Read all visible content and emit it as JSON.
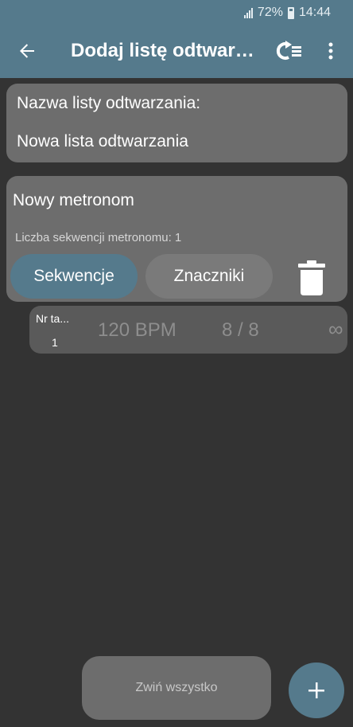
{
  "status_bar": {
    "battery": "72%",
    "time": "14:44"
  },
  "app_bar": {
    "title": "Dodaj listę odtwarzania",
    "back_icon": "arrow-left-icon",
    "sync_icon": "sync-list-icon",
    "menu_icon": "more-vert-icon"
  },
  "playlist": {
    "label": "Nazwa listy odtwarzania:",
    "name_value": "Nowa lista odtwarzania"
  },
  "metronome": {
    "name": "Nowy metronom",
    "sequence_count_text": "Liczba sekwencji metronomu: 1",
    "sequences_button": "Sekwencje",
    "markers_button": "Znaczniki",
    "delete_icon": "trash-icon"
  },
  "sequence": {
    "nr_label": "Nr ta...",
    "nr_value": "1",
    "bpm": "120 BPM",
    "time_signature": "8 / 8",
    "loop": "∞"
  },
  "footer": {
    "collapse_all": "Zwiń wszystko",
    "fab_icon": "plus-icon"
  },
  "colors": {
    "accent": "#557a8c",
    "card": "#6d6d6d",
    "background": "#333333"
  }
}
